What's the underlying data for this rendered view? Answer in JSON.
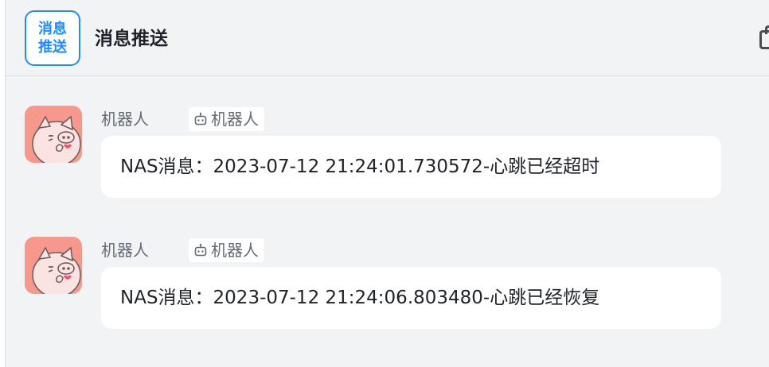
{
  "header": {
    "logo_line1": "消息",
    "logo_line2": "推送",
    "title": "消息推送"
  },
  "messages": [
    {
      "sender": "机器人",
      "badge": "机器人",
      "text": "NAS消息：2023-07-12 21:24:01.730572-心跳已经超时"
    },
    {
      "sender": "机器人",
      "badge": "机器人",
      "text": "NAS消息：2023-07-12 21:24:06.803480-心跳已经恢复"
    }
  ],
  "colors": {
    "accent": "#1f8bff",
    "background": "#f2f3f5",
    "avatar_bg": "#f6988c",
    "bubble_bg": "#ffffff",
    "meta_text": "#646a73"
  },
  "icons": {
    "header_action": "share-icon",
    "badge": "robot-icon",
    "avatar": "pig-avatar"
  }
}
